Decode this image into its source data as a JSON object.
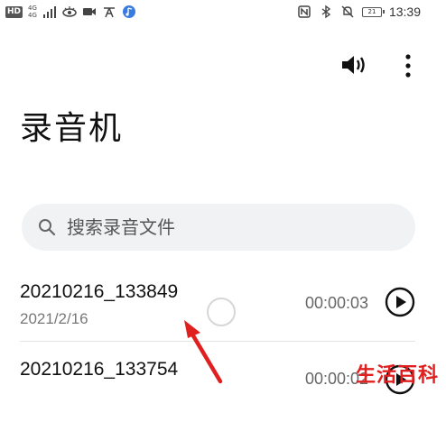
{
  "status_bar": {
    "left_badge": "HD",
    "network_tag_top": "4G",
    "network_tag_bottom": "4G",
    "battery_level": "21",
    "time": "13:39"
  },
  "app": {
    "title": "录音机"
  },
  "search": {
    "placeholder": "搜索录音文件"
  },
  "recordings": [
    {
      "name": "20210216_133849",
      "date": "2021/2/16",
      "duration": "00:00:03"
    },
    {
      "name": "20210216_133754",
      "date": "",
      "duration": "00:00:02"
    }
  ],
  "watermark": "生活百科",
  "icons": {
    "speaker": "speaker-icon",
    "more": "more-vertical-icon",
    "search": "search-icon",
    "play": "play-icon"
  },
  "colors": {
    "annotation": "#e02020",
    "search_bg": "#f1f2f4",
    "text": "#111111",
    "secondary_text": "#777777"
  }
}
